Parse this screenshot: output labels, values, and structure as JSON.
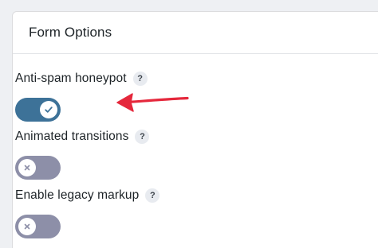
{
  "panel": {
    "title": "Form Options"
  },
  "options": [
    {
      "label": "Anti-spam honeypot",
      "help": "?",
      "enabled": true
    },
    {
      "label": "Animated transitions",
      "help": "?",
      "enabled": false
    },
    {
      "label": "Enable legacy markup",
      "help": "?",
      "enabled": false
    }
  ],
  "colors": {
    "toggle_on": "#3d7298",
    "toggle_off": "#8d8fa8",
    "annotation_arrow": "#e5283c"
  },
  "icons": {
    "check": "check-icon",
    "close": "close-icon",
    "arrow": "red-arrow-annotation"
  }
}
